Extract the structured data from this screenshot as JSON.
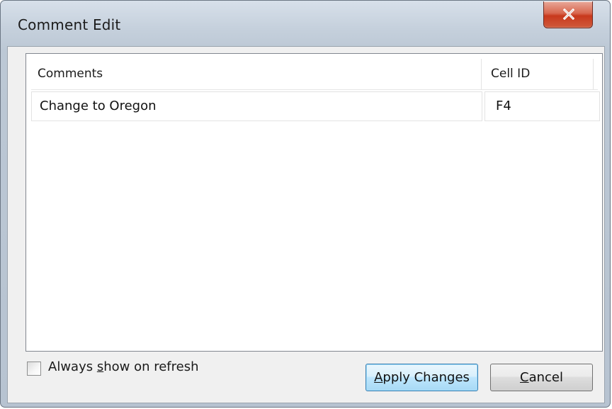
{
  "window": {
    "title": "Comment Edit",
    "close_icon": "close-x-icon"
  },
  "table": {
    "columns": [
      "Comments",
      "Cell ID"
    ],
    "rows": [
      {
        "comment": "Change to Oregon",
        "cell_id": "F4"
      }
    ]
  },
  "options": {
    "always_show": {
      "label_pre": "Always ",
      "label_accel": "s",
      "label_post": "how on refresh",
      "checked": false
    }
  },
  "buttons": {
    "apply": {
      "accel": "A",
      "rest": "pply Changes"
    },
    "cancel": {
      "accel": "C",
      "rest": "ancel"
    }
  },
  "colors": {
    "close_button": "#c8391d",
    "apply_focus_border": "#3c7fb1"
  }
}
